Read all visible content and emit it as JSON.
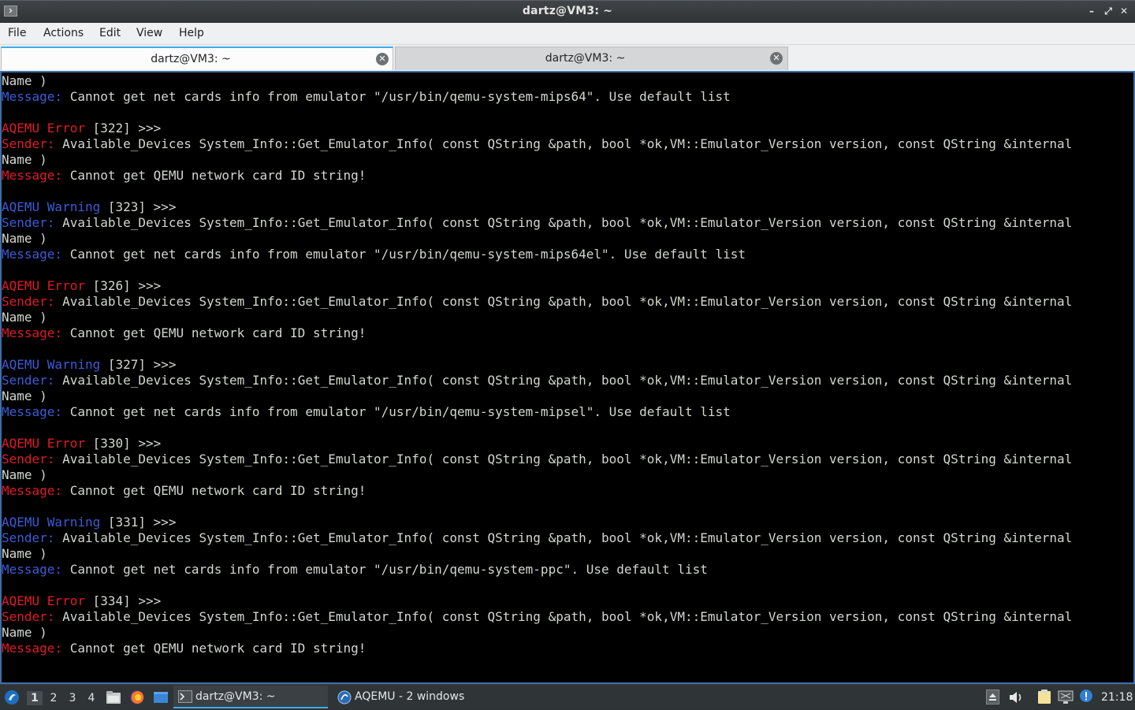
{
  "window": {
    "title": "dartz@VM3: ~",
    "minimize_icon": "minimize-icon",
    "maximize_icon": "restore-icon",
    "close_icon": "close-icon"
  },
  "menu": {
    "items": [
      "File",
      "Actions",
      "Edit",
      "View",
      "Help"
    ]
  },
  "tabs": [
    {
      "label": "dartz@VM3: ~",
      "active": true
    },
    {
      "label": "dartz@VM3: ~",
      "active": false
    }
  ],
  "terminal": {
    "colors": {
      "error": "#e01b24",
      "warning": "#3c5bd8",
      "text": "#d3d7cf",
      "background": "#000000"
    },
    "lines": [
      [
        [
          "Name )",
          "white"
        ]
      ],
      [
        [
          "Message:",
          "blue"
        ],
        [
          " Cannot get net cards info from emulator \"/usr/bin/qemu-system-mips64\". Use default list",
          "white"
        ]
      ],
      [],
      [
        [
          "AQEMU Error",
          "red"
        ],
        [
          " [322] >>>",
          "white"
        ]
      ],
      [
        [
          "Sender:",
          "red"
        ],
        [
          " Available_Devices System_Info::Get_Emulator_Info( const QString &path, bool *ok,VM::Emulator_Version version, const QString &internal",
          "white"
        ]
      ],
      [
        [
          "Name )",
          "white"
        ]
      ],
      [
        [
          "Message:",
          "red"
        ],
        [
          " Cannot get QEMU network card ID string!",
          "white"
        ]
      ],
      [],
      [
        [
          "AQEMU Warning",
          "blue"
        ],
        [
          " [323] >>>",
          "white"
        ]
      ],
      [
        [
          "Sender:",
          "blue"
        ],
        [
          " Available_Devices System_Info::Get_Emulator_Info( const QString &path, bool *ok,VM::Emulator_Version version, const QString &internal",
          "white"
        ]
      ],
      [
        [
          "Name )",
          "white"
        ]
      ],
      [
        [
          "Message:",
          "blue"
        ],
        [
          " Cannot get net cards info from emulator \"/usr/bin/qemu-system-mips64el\". Use default list",
          "white"
        ]
      ],
      [],
      [
        [
          "AQEMU Error",
          "red"
        ],
        [
          " [326] >>>",
          "white"
        ]
      ],
      [
        [
          "Sender:",
          "red"
        ],
        [
          " Available_Devices System_Info::Get_Emulator_Info( const QString &path, bool *ok,VM::Emulator_Version version, const QString &internal",
          "white"
        ]
      ],
      [
        [
          "Name )",
          "white"
        ]
      ],
      [
        [
          "Message:",
          "red"
        ],
        [
          " Cannot get QEMU network card ID string!",
          "white"
        ]
      ],
      [],
      [
        [
          "AQEMU Warning",
          "blue"
        ],
        [
          " [327] >>>",
          "white"
        ]
      ],
      [
        [
          "Sender:",
          "blue"
        ],
        [
          " Available_Devices System_Info::Get_Emulator_Info( const QString &path, bool *ok,VM::Emulator_Version version, const QString &internal",
          "white"
        ]
      ],
      [
        [
          "Name )",
          "white"
        ]
      ],
      [
        [
          "Message:",
          "blue"
        ],
        [
          " Cannot get net cards info from emulator \"/usr/bin/qemu-system-mipsel\". Use default list",
          "white"
        ]
      ],
      [],
      [
        [
          "AQEMU Error",
          "red"
        ],
        [
          " [330] >>>",
          "white"
        ]
      ],
      [
        [
          "Sender:",
          "red"
        ],
        [
          " Available_Devices System_Info::Get_Emulator_Info( const QString &path, bool *ok,VM::Emulator_Version version, const QString &internal",
          "white"
        ]
      ],
      [
        [
          "Name )",
          "white"
        ]
      ],
      [
        [
          "Message:",
          "red"
        ],
        [
          " Cannot get QEMU network card ID string!",
          "white"
        ]
      ],
      [],
      [
        [
          "AQEMU Warning",
          "blue"
        ],
        [
          " [331] >>>",
          "white"
        ]
      ],
      [
        [
          "Sender:",
          "blue"
        ],
        [
          " Available_Devices System_Info::Get_Emulator_Info( const QString &path, bool *ok,VM::Emulator_Version version, const QString &internal",
          "white"
        ]
      ],
      [
        [
          "Name )",
          "white"
        ]
      ],
      [
        [
          "Message:",
          "blue"
        ],
        [
          " Cannot get net cards info from emulator \"/usr/bin/qemu-system-ppc\". Use default list",
          "white"
        ]
      ],
      [],
      [
        [
          "AQEMU Error",
          "red"
        ],
        [
          " [334] >>>",
          "white"
        ]
      ],
      [
        [
          "Sender:",
          "red"
        ],
        [
          " Available_Devices System_Info::Get_Emulator_Info( const QString &path, bool *ok,VM::Emulator_Version version, const QString &internal",
          "white"
        ]
      ],
      [
        [
          "Name )",
          "white"
        ]
      ],
      [
        [
          "Message:",
          "red"
        ],
        [
          " Cannot get QEMU network card ID string!",
          "white"
        ]
      ]
    ]
  },
  "taskbar": {
    "start_icon": "lubuntu-menu-icon",
    "workspaces": [
      "1",
      "2",
      "3",
      "4"
    ],
    "active_workspace": "1",
    "launchers": [
      "file-manager-icon",
      "firefox-icon",
      "show-desktop-icon"
    ],
    "tasks": [
      {
        "label": "dartz@VM3: ~",
        "icon": "terminal-icon",
        "active": true
      },
      {
        "label": "AQEMU - 2 windows",
        "icon": "aqemu-icon",
        "active": false
      }
    ],
    "tray_icons": [
      "eject-icon",
      "volume-icon",
      "clipboard-icon",
      "network-icon",
      "update-notifier-icon"
    ],
    "clock": "21:18"
  }
}
